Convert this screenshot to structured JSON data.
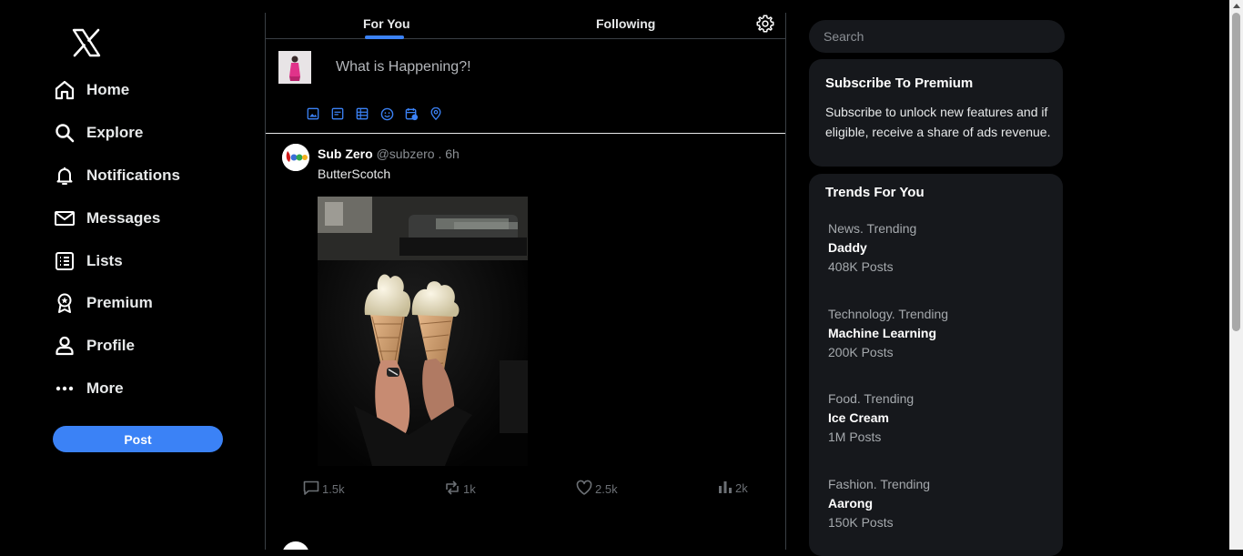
{
  "app": {
    "logo": "x-logo-icon",
    "accent_color": "#3b82f6"
  },
  "sidebar": {
    "items": [
      {
        "label": "Home",
        "icon": "home-icon"
      },
      {
        "label": "Explore",
        "icon": "search-icon"
      },
      {
        "label": "Notifications",
        "icon": "bell-icon"
      },
      {
        "label": "Messages",
        "icon": "envelope-icon"
      },
      {
        "label": "Lists",
        "icon": "list-icon"
      },
      {
        "label": "Premium",
        "icon": "badge-icon"
      },
      {
        "label": "Profile",
        "icon": "person-icon"
      },
      {
        "label": "More",
        "icon": "ellipsis-icon"
      }
    ],
    "post_label": "Post"
  },
  "main": {
    "tabs": [
      {
        "label": "For You",
        "active": true
      },
      {
        "label": "Following",
        "active": false
      }
    ],
    "composer": {
      "placeholder": "What is Happening?!",
      "tools": [
        "image-icon",
        "gif-icon",
        "poll-icon",
        "emoji-icon",
        "schedule-icon",
        "location-icon"
      ]
    },
    "tweet": {
      "author": "Sub Zero",
      "handle": "@subzero",
      "separator": " . ",
      "time": "6h",
      "text": "ButterScotch",
      "media": "ice-cream-cones-image",
      "stats": {
        "replies": "1.5k",
        "retweets": "1k",
        "likes": "2.5k",
        "views": "2k"
      }
    }
  },
  "right": {
    "search": {
      "placeholder": "Search"
    },
    "premium": {
      "title": "Subscribe To Premium",
      "description": "Subscribe to unlock new features and if eligible, receive a share of ads revenue."
    },
    "trends": {
      "title": "Trends For You",
      "items": [
        {
          "category": "News. Trending",
          "name": "Daddy",
          "count": "408K Posts"
        },
        {
          "category": "Technology. Trending",
          "name": "Machine Learning",
          "count": "200K Posts"
        },
        {
          "category": "Food. Trending",
          "name": "Ice Cream",
          "count": "1M Posts"
        },
        {
          "category": "Fashion. Trending",
          "name": "Aarong",
          "count": "150K Posts"
        }
      ]
    }
  }
}
